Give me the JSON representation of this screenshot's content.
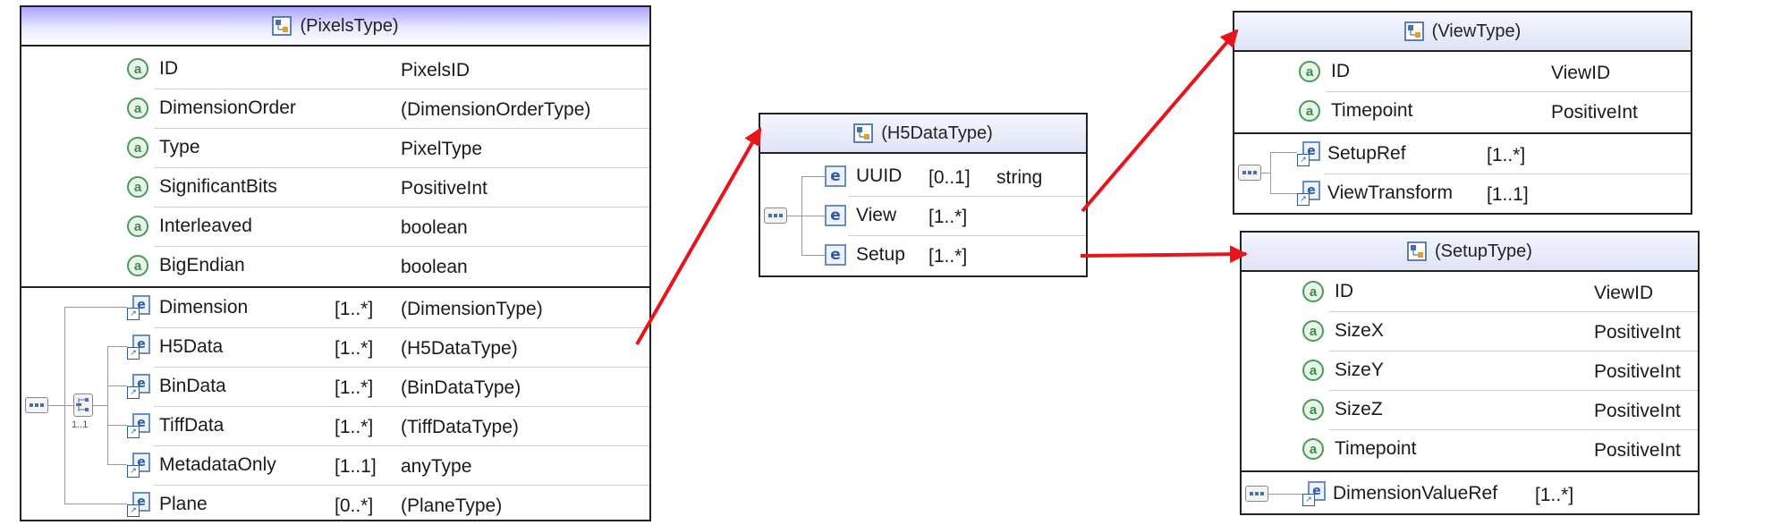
{
  "pixels": {
    "title": "(PixelsType)",
    "attrs": [
      {
        "name": "ID",
        "type": "PixelsID"
      },
      {
        "name": "DimensionOrder",
        "type": "(DimensionOrderType)"
      },
      {
        "name": "Type",
        "type": "PixelType"
      },
      {
        "name": "SignificantBits",
        "type": "PositiveInt"
      },
      {
        "name": "Interleaved",
        "type": "boolean"
      },
      {
        "name": "BigEndian",
        "type": "boolean"
      }
    ],
    "elements": [
      {
        "name": "Dimension",
        "card": "[1..*]",
        "type": "(DimensionType)"
      },
      {
        "name": "H5Data",
        "card": "[1..*]",
        "type": "(H5DataType)"
      },
      {
        "name": "BinData",
        "card": "[1..*]",
        "type": "(BinDataType)"
      },
      {
        "name": "TiffData",
        "card": "[1..*]",
        "type": "(TiffDataType)"
      },
      {
        "name": "MetadataOnly",
        "card": "[1..1]",
        "type": "anyType"
      },
      {
        "name": "Plane",
        "card": "[0..*]",
        "type": "(PlaneType)"
      }
    ],
    "choice_card": "1..1"
  },
  "h5data": {
    "title": "(H5DataType)",
    "elements": [
      {
        "name": "UUID",
        "card": "[0..1]",
        "type": "string"
      },
      {
        "name": "View",
        "card": "[1..*]",
        "type": ""
      },
      {
        "name": "Setup",
        "card": "[1..*]",
        "type": ""
      }
    ]
  },
  "view": {
    "title": "(ViewType)",
    "attrs": [
      {
        "name": "ID",
        "type": "ViewID"
      },
      {
        "name": "Timepoint",
        "type": "PositiveInt"
      }
    ],
    "elements": [
      {
        "name": "SetupRef",
        "card": "[1..*]"
      },
      {
        "name": "ViewTransform",
        "card": "[1..1]"
      }
    ]
  },
  "setup": {
    "title": "(SetupType)",
    "attrs": [
      {
        "name": "ID",
        "type": "ViewID"
      },
      {
        "name": "SizeX",
        "type": "PositiveInt"
      },
      {
        "name": "SizeY",
        "type": "PositiveInt"
      },
      {
        "name": "SizeZ",
        "type": "PositiveInt"
      },
      {
        "name": "Timepoint",
        "type": "PositiveInt"
      }
    ],
    "elements": [
      {
        "name": "DimensionValueRef",
        "card": "[1..*]"
      }
    ]
  },
  "icons": {
    "attribute": "attribute-icon",
    "element": "element-icon",
    "element_ref": "element-ref-icon",
    "type": "complex-type-icon",
    "sequence": "sequence-icon",
    "choice": "choice-icon"
  },
  "colors": {
    "arrow": "#e8141b",
    "attribute": "#3b8a4c",
    "element": "#2c5aa0",
    "pixels_header": "#a9a4ff"
  }
}
